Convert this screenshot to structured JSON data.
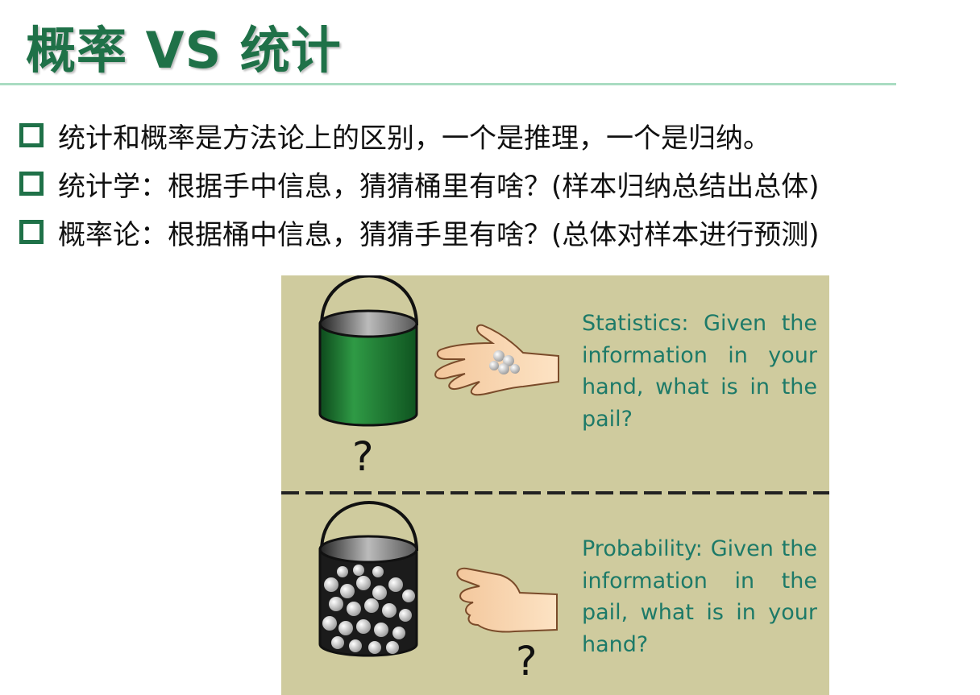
{
  "title": "概率 VS 统计",
  "bullets": [
    {
      "text": "统计和概率是方法论上的区别，一个是推理，一个是归纳。"
    },
    {
      "text": "统计学：根据手中信息，猜猜桶里有啥？(样本归纳总结出总体)"
    },
    {
      "text": "概率论：根据桶中信息，猜猜手里有啥？(总体对样本进行预测)"
    }
  ],
  "figure": {
    "statistics_caption": "Statistics: Given the information in your hand, what is in the pail?",
    "probability_caption": "Probability: Given the information in the pail, what is in your hand?",
    "question_mark_top": "?",
    "question_mark_bottom": "?",
    "icons": [
      "green-pail-icon",
      "hand-with-balls-icon",
      "pail-with-balls-icon",
      "closed-hand-icon"
    ]
  },
  "colors": {
    "title_green": "#1f7148",
    "rule": "#a9dcc2",
    "figure_background": "#cfcb9e",
    "caption_text": "#1d7a68",
    "pail_green": "#1e7b33"
  }
}
